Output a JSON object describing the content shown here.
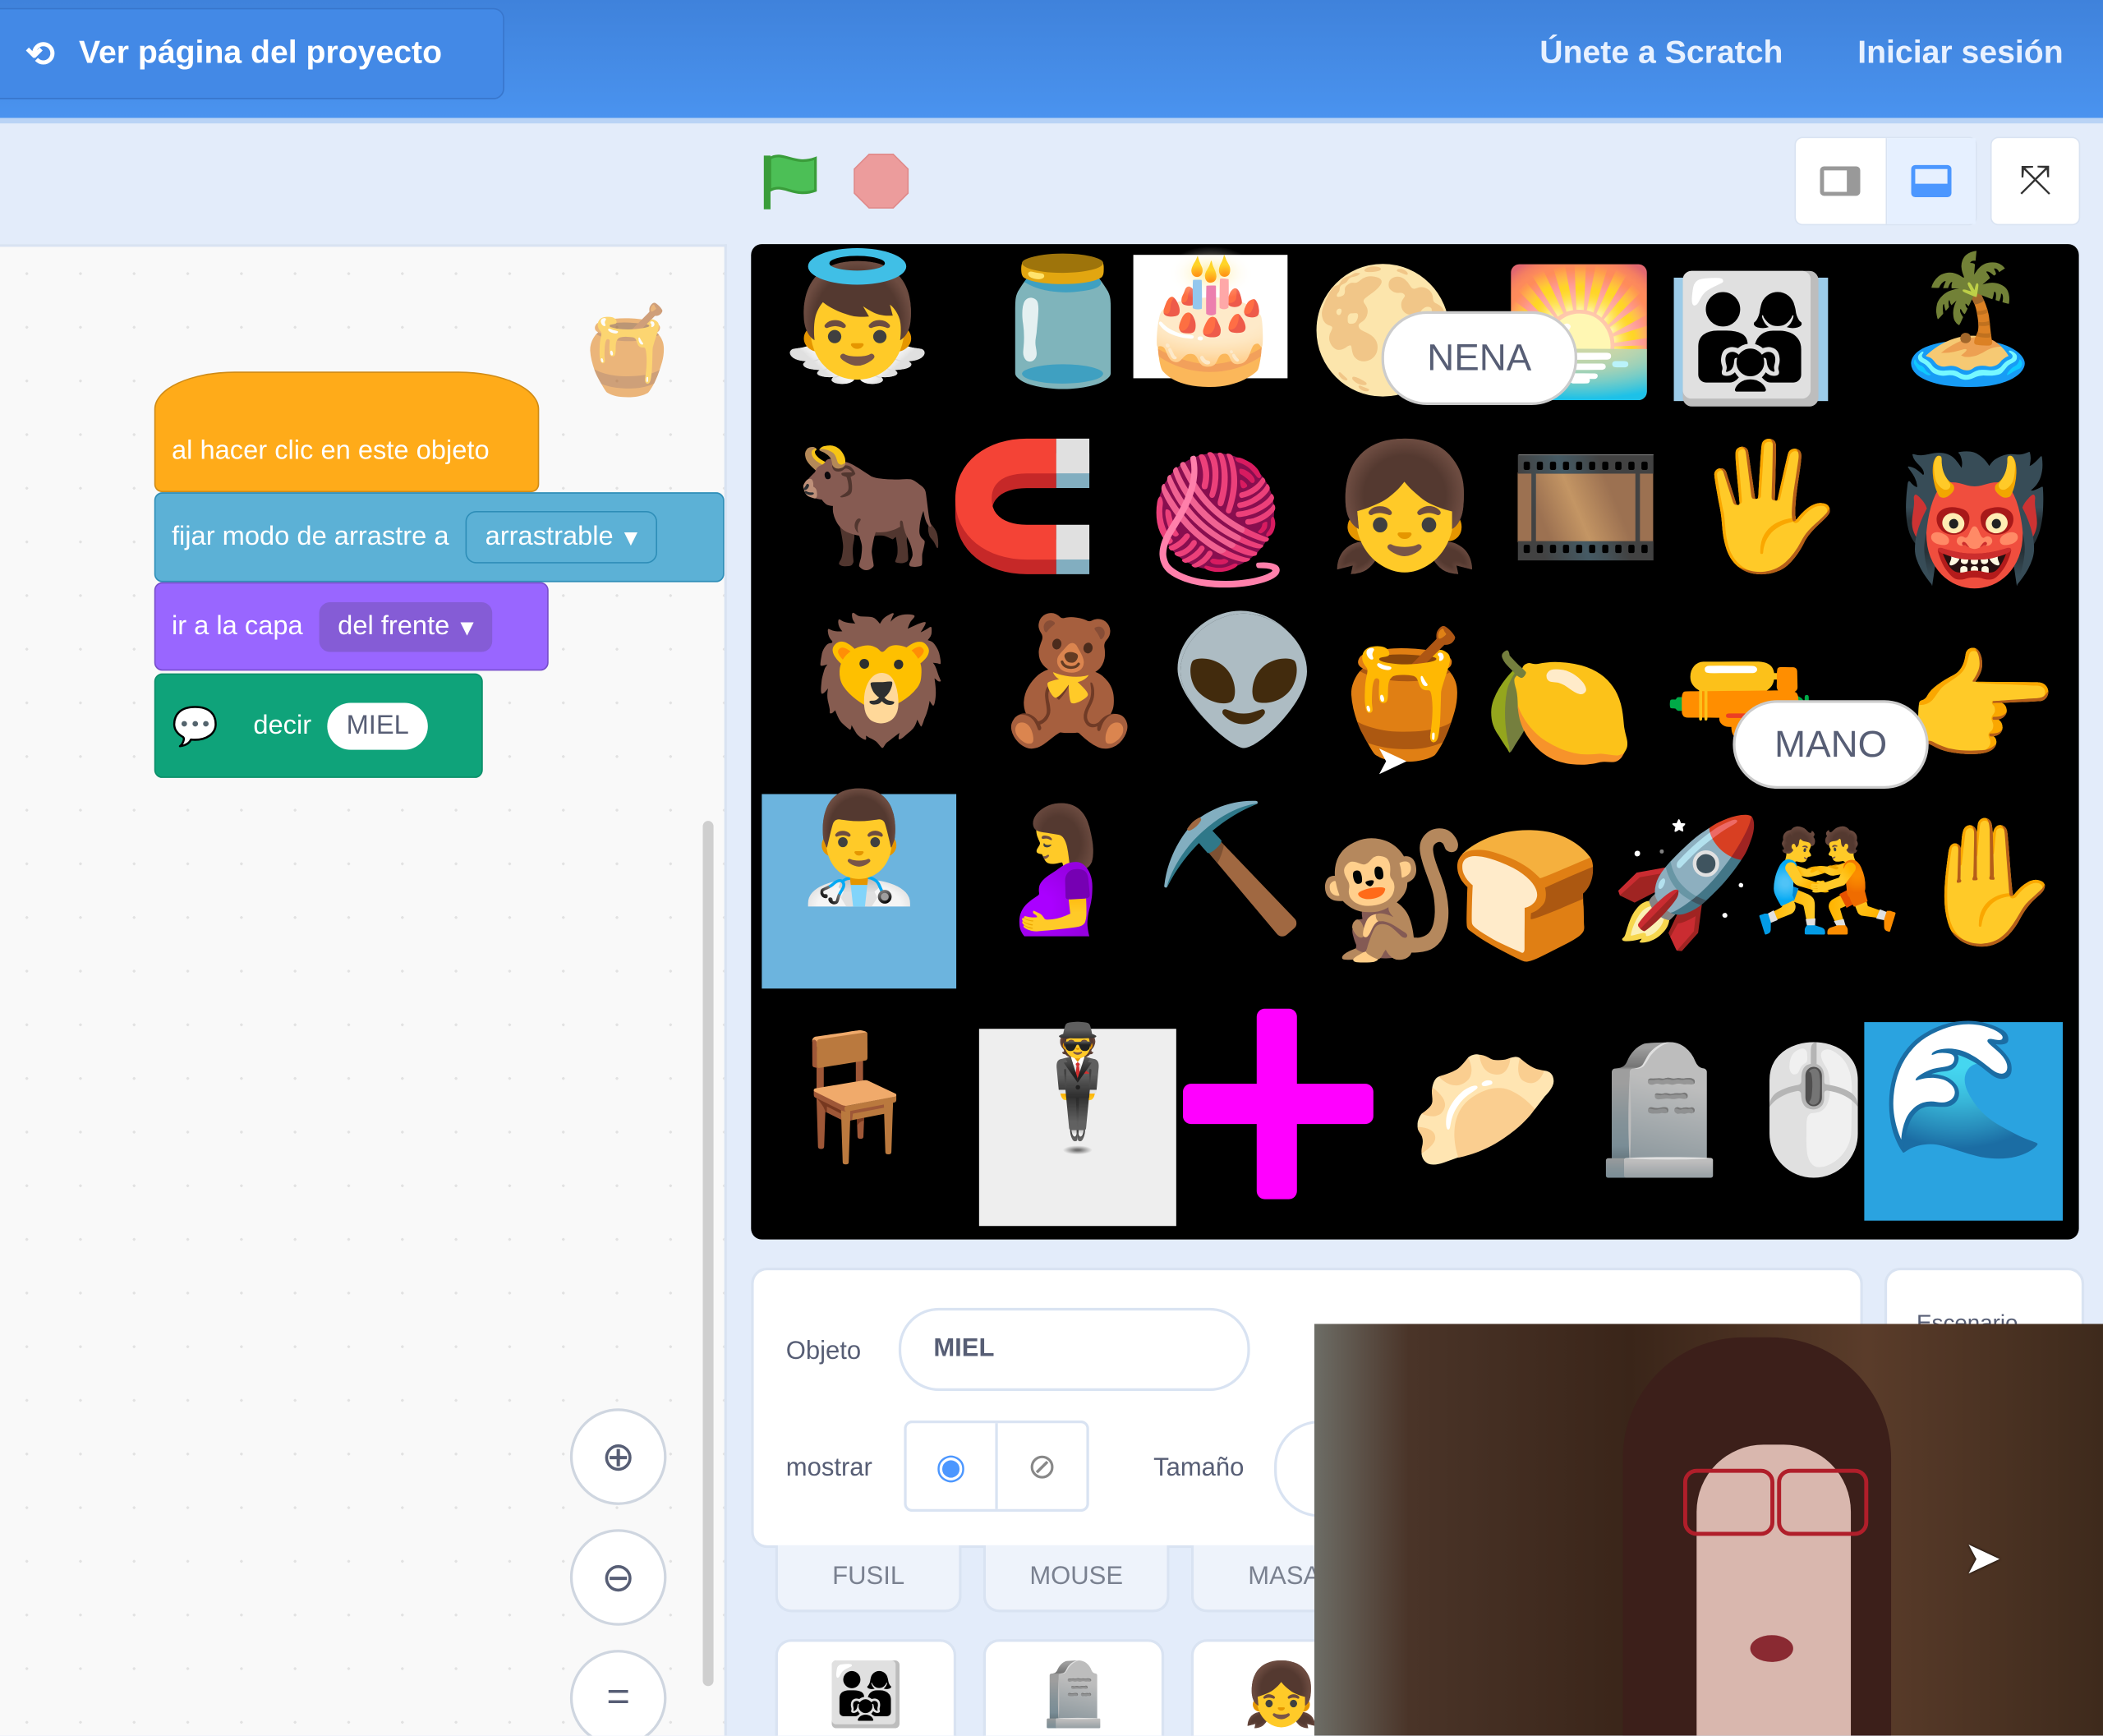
{
  "header": {
    "view_project": "Ver página del proyecto",
    "join": "Únete a Scratch",
    "sign_in": "Iniciar sesión"
  },
  "blocks": {
    "hat": "al hacer clic en este objeto",
    "drag": "fijar modo de arrastre a",
    "drag_value": "arrastrable",
    "layer": "ir a la capa",
    "layer_value": "del frente",
    "say": "decir",
    "say_value": "MIEL"
  },
  "stage": {
    "bubbles": [
      "NENA",
      "MANO"
    ]
  },
  "sprite_info": {
    "name_label": "Objeto",
    "name_value": "MIEL",
    "show_label": "mostrar",
    "size_label": "Tamaño"
  },
  "sprites": [
    "FUSIL",
    "MOUSE",
    "MASA"
  ],
  "stage_panel": {
    "label": "Escenario"
  },
  "colors": {
    "events": "#ffab19",
    "sensing": "#5cb1d6",
    "looks": "#9966ff",
    "extension": "#0fbd8c",
    "topbar": "#4a93ef"
  }
}
